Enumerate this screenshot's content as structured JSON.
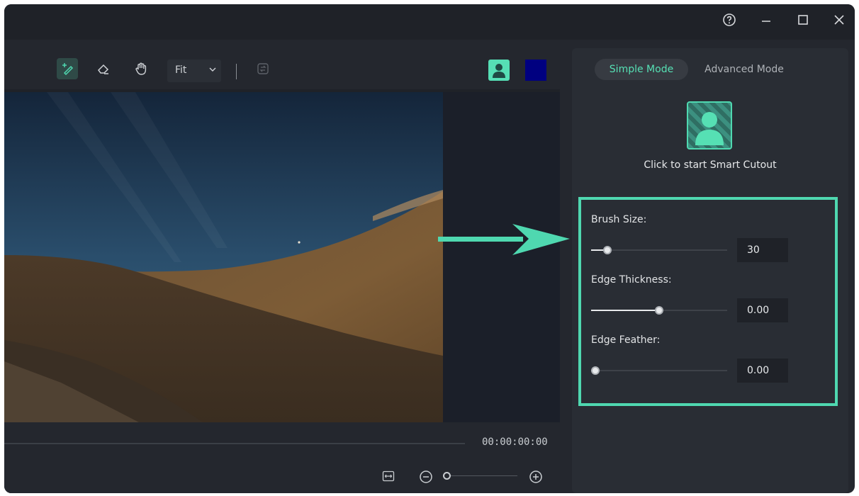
{
  "window": {
    "help_icon": "help-circle-icon",
    "controls": [
      "minimize-icon",
      "maximize-icon",
      "close-icon"
    ]
  },
  "toolbar": {
    "tools": [
      "smart-brush-icon",
      "eraser-icon",
      "hand-icon"
    ],
    "zoom_select": {
      "value": "Fit"
    },
    "right_icons": [
      "person-cutout-icon",
      "background-color-swatch"
    ],
    "swatch_color": "#000080"
  },
  "player": {
    "timecode": "00:00:00:00",
    "controls": [
      "fit-width-icon",
      "zoom-out-icon",
      "zoom-in-icon"
    ],
    "zoom_level": 0.05
  },
  "panel": {
    "modes": {
      "simple": "Simple Mode",
      "advanced": "Advanced Mode"
    },
    "active_mode": "simple",
    "cutout_prompt": "Click to start Smart Cutout",
    "params": {
      "brush_size": {
        "label": "Brush Size:",
        "value": "30",
        "slider": 0.12
      },
      "edge_thickness": {
        "label": "Edge Thickness:",
        "value": "0.00",
        "slider": 0.5
      },
      "edge_feather": {
        "label": "Edge Feather:",
        "value": "0.00",
        "slider": 0.03
      }
    }
  },
  "colors": {
    "accent": "#4fd8b0",
    "window_bg": "#24272e",
    "panel_bg": "#292d34"
  }
}
